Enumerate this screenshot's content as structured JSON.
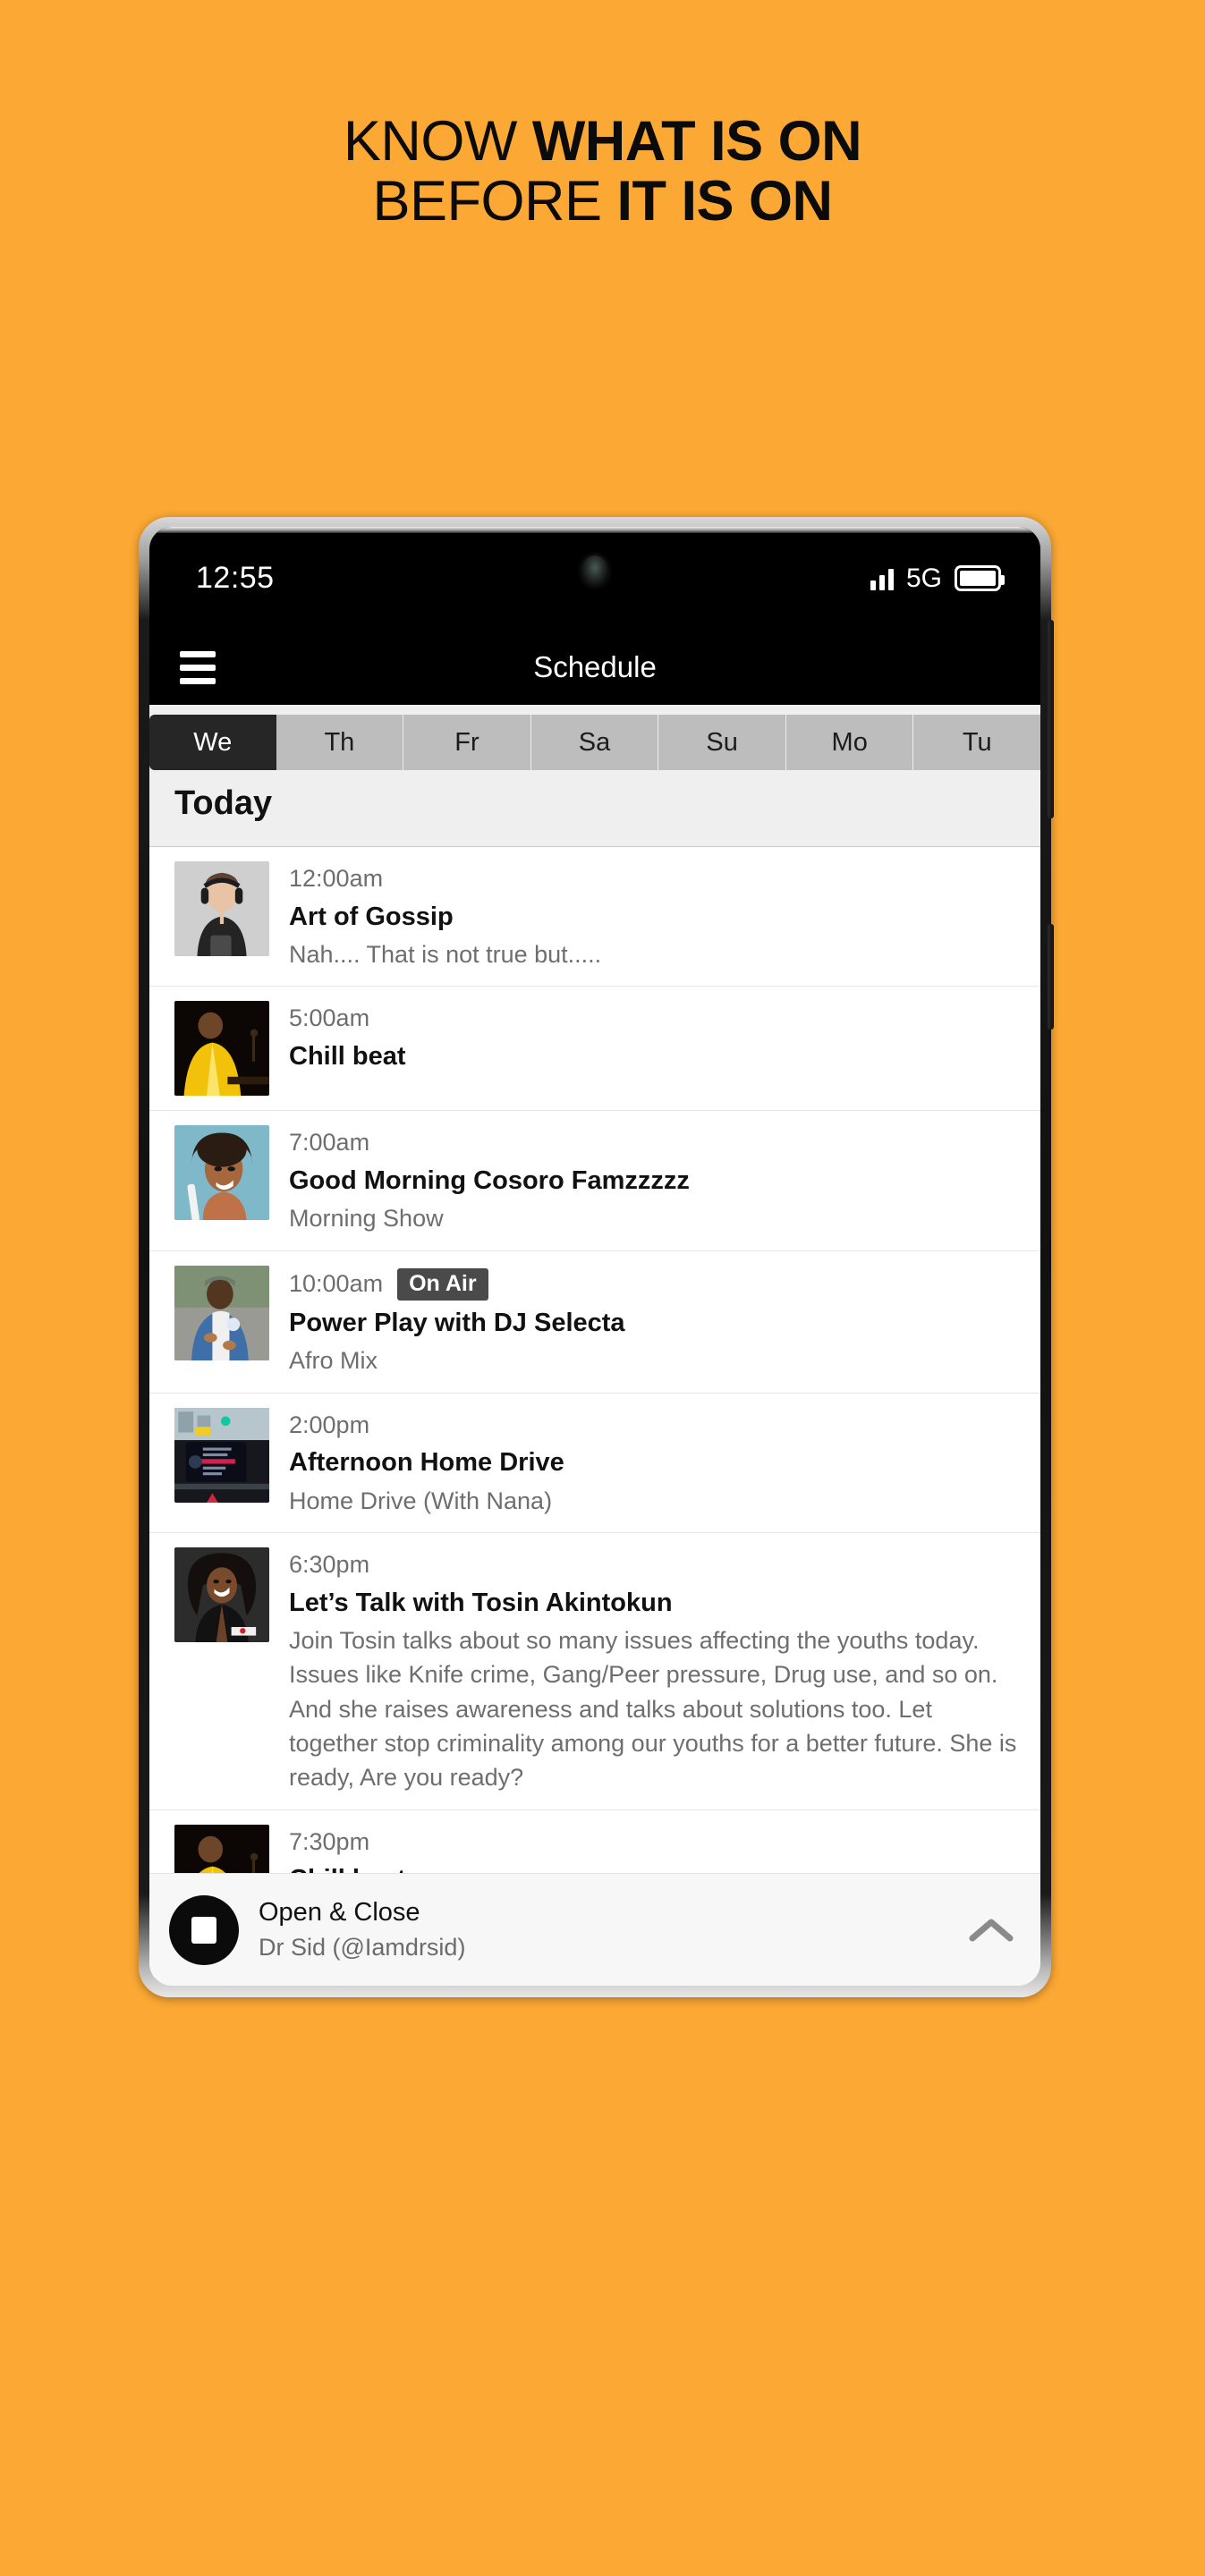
{
  "promo": {
    "line1_regular": "KNOW ",
    "line1_bold": "WHAT IS ON",
    "line2_regular": "BEFORE ",
    "line2_bold": "IT IS ON",
    "background_color": "#fba834"
  },
  "status_bar": {
    "time": "12:55",
    "network": "5G",
    "signal_icon": "signal-bars-icon",
    "battery_icon": "battery-full-icon",
    "camera_icon": "front-camera-icon"
  },
  "app_bar": {
    "menu_icon": "hamburger-menu-icon",
    "title": "Schedule"
  },
  "day_tabs": {
    "selected": "We",
    "items": [
      {
        "label": "We",
        "active": true
      },
      {
        "label": "Th",
        "active": false
      },
      {
        "label": "Fr",
        "active": false
      },
      {
        "label": "Sa",
        "active": false
      },
      {
        "label": "Su",
        "active": false
      },
      {
        "label": "Mo",
        "active": false
      },
      {
        "label": "Tu",
        "active": false
      }
    ]
  },
  "section": {
    "heading": "Today"
  },
  "schedule": [
    {
      "time": "12:00am",
      "badge": "",
      "title": "Art of Gossip",
      "subtitle": "Nah.... That is not true but.....",
      "thumb": "man-with-headphones-shushing"
    },
    {
      "time": "5:00am",
      "badge": "",
      "title": "Chill beat",
      "subtitle": "",
      "thumb": "pianist-in-yellow-jacket"
    },
    {
      "time": "7:00am",
      "badge": "",
      "title": "Good Morning Cosoro Famzzzzz",
      "subtitle": "Morning Show",
      "thumb": "woman-with-toothbrush"
    },
    {
      "time": "10:00am",
      "badge": "On Air",
      "title": "Power Play with DJ Selecta",
      "subtitle": "Afro Mix",
      "thumb": "man-in-denim-shirt-and-cap"
    },
    {
      "time": "2:00pm",
      "badge": "",
      "title": "Afternoon Home Drive",
      "subtitle": "Home Drive (With Nana)",
      "thumb": "car-dashboard-radio-display"
    },
    {
      "time": "6:30pm",
      "badge": "",
      "title": "Let’s Talk with Tosin Akintokun",
      "subtitle": "Join Tosin talks about so many issues affecting the youths today. Issues like Knife crime, Gang/Peer pressure, Drug use, and so on. And she raises awareness and talks about solutions too. Let together stop criminality among our youths for a better future. She is ready, Are you ready?",
      "thumb": "smiling-woman-in-studio"
    },
    {
      "time": "7:30pm",
      "badge": "",
      "title": "Chill beat",
      "subtitle": "",
      "thumb": "pianist-in-yellow-jacket"
    }
  ],
  "player": {
    "stop_icon": "stop-button-icon",
    "title": "Open & Close",
    "subtitle": "Dr Sid (@Iamdrsid)",
    "expand_icon": "chevron-up-icon"
  }
}
